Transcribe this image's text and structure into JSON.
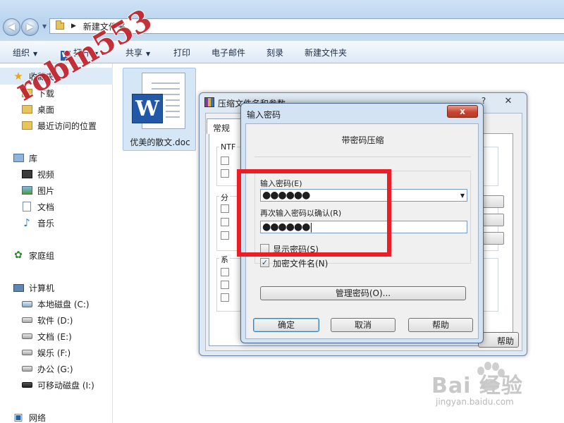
{
  "window": {
    "address_path": "新建文件夹",
    "nav_back_icon": "back-arrow-icon",
    "nav_forward_icon": "forward-arrow-icon"
  },
  "toolbar": {
    "organize": "组织",
    "open": "打开",
    "share": "共享",
    "print": "打印",
    "email": "电子邮件",
    "burn": "刻录",
    "new_folder": "新建文件夹"
  },
  "sidebar": {
    "favorites": {
      "label": "收藏夹",
      "items": [
        {
          "label": "下载",
          "icon": "folder-icon"
        },
        {
          "label": "桌面",
          "icon": "folder-icon"
        },
        {
          "label": "最近访问的位置",
          "icon": "folder-icon"
        }
      ]
    },
    "libraries": {
      "label": "库",
      "items": [
        {
          "label": "视频",
          "icon": "video-icon"
        },
        {
          "label": "图片",
          "icon": "picture-icon"
        },
        {
          "label": "文档",
          "icon": "document-icon"
        },
        {
          "label": "音乐",
          "icon": "music-icon"
        }
      ]
    },
    "homegroup": {
      "label": "家庭组"
    },
    "computer": {
      "label": "计算机",
      "drives": [
        {
          "label": "本地磁盘 (C:)"
        },
        {
          "label": "软件 (D:)"
        },
        {
          "label": "文档 (E:)"
        },
        {
          "label": "娱乐 (F:)"
        },
        {
          "label": "办公 (G:)"
        },
        {
          "label": "可移动磁盘 (I:)"
        }
      ]
    },
    "network": {
      "label": "网络"
    }
  },
  "files": [
    {
      "name": "优美的散文.doc",
      "icon": "word-document-icon",
      "selected": true
    }
  ],
  "archive_dialog": {
    "title": "压缩文件名和参数",
    "help_glyph": "?",
    "close_glyph": "✕",
    "tab": "常规",
    "group1_label": "NTF",
    "group2_label": "分",
    "group3_label": "系",
    "help_button": "帮助"
  },
  "password_dialog": {
    "title": "输入密码",
    "close_glyph": "x",
    "heading": "带密码压缩",
    "enter_label": "输入密码(E)",
    "enter_value": "●●●●●●",
    "confirm_label": "再次输入密码以确认(R)",
    "confirm_value": "●●●●●●",
    "show_password": {
      "label": "显示密码(S)",
      "checked": false
    },
    "encrypt_names": {
      "label": "加密文件名(N)",
      "checked": true
    },
    "manage_button": "管理密码(O)...",
    "ok_button": "确定",
    "cancel_button": "取消",
    "help_button": "帮助",
    "checkmark": "✓"
  },
  "watermarks": {
    "author": "robin553",
    "baidu": "Bai 经验",
    "baidu_url": "jingyan.baidu.com"
  },
  "colors": {
    "highlight_box": "#ee1c24",
    "close_button": "#c7452f"
  }
}
